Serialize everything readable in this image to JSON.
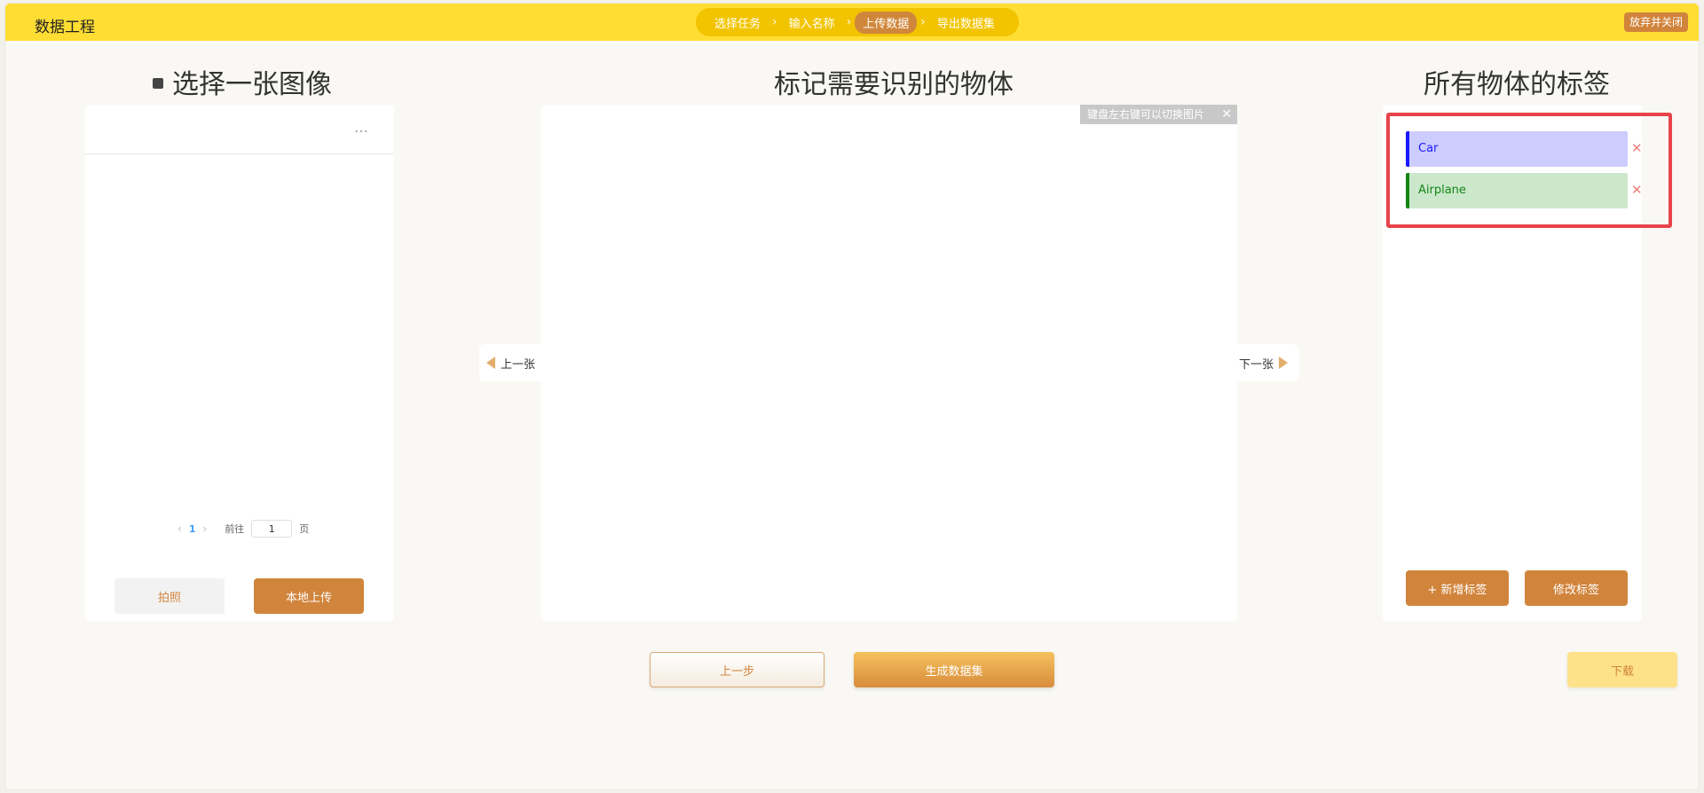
{
  "app": {
    "title": "数据工程"
  },
  "steps": [
    {
      "label": "选择任务",
      "active": false
    },
    {
      "label": "输入名称",
      "active": false
    },
    {
      "label": "上传数据",
      "active": true
    },
    {
      "label": "导出数据集",
      "active": false
    }
  ],
  "header": {
    "close_label": "放弃并关闭"
  },
  "sections": {
    "left_title": "选择一张图像",
    "center_title": "标记需要识别的物体",
    "right_title": "所有物体的标签"
  },
  "left_panel": {
    "more_icon": "…",
    "pager": {
      "current_page": "1",
      "goto_label": "前往",
      "goto_value": "1",
      "page_suffix": "页"
    },
    "photo_button": "拍照",
    "upload_button": "本地上传"
  },
  "canvas": {
    "hint": "键盘左右键可以切换图片",
    "hint_close": "✕",
    "prev_label": "上一张",
    "next_label": "下一张"
  },
  "labels": {
    "items": [
      {
        "name": "Car",
        "color": "#1a1aff",
        "bg": "#ccccff"
      },
      {
        "name": "Airplane",
        "color": "#158515",
        "bg": "#cce8cc"
      }
    ],
    "delete_icon": "✕",
    "add_button": "+ 新增标签",
    "edit_button": "修改标签"
  },
  "footer": {
    "prev_step": "上一步",
    "generate": "生成数据集",
    "download": "下载"
  },
  "colors": {
    "topbar": "#ffdd33",
    "accent": "#d1843c",
    "highlight": "#e8434b"
  }
}
